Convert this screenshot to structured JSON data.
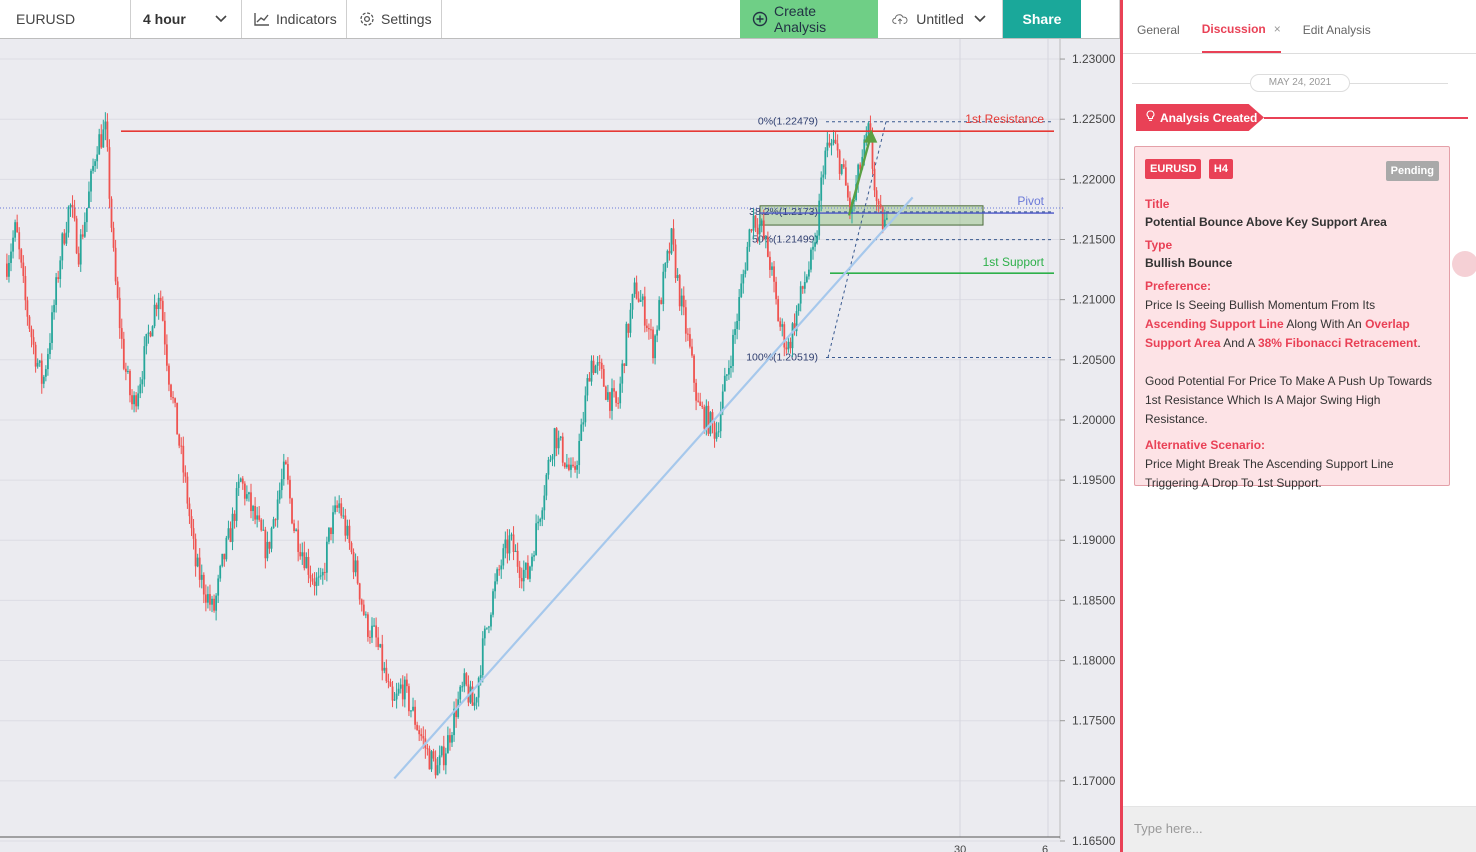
{
  "toolbar": {
    "symbol": "EURUSD",
    "interval": "4 hour",
    "indicators_label": "Indicators",
    "settings_label": "Settings",
    "create_label": "Create Analysis",
    "untitled_label": "Untitled",
    "share_label": "Share",
    "accent_green": "#6fcf86",
    "accent_teal": "#1aa89a"
  },
  "chart": {
    "price_axis": [
      "1.23000",
      "1.22500",
      "1.22000",
      "1.21500",
      "1.21000",
      "1.20500",
      "1.20000",
      "1.19500",
      "1.19000",
      "1.18500",
      "1.18000",
      "1.17500",
      "1.17000",
      "1.16500"
    ],
    "time_axis": [
      "30",
      "6"
    ],
    "annotations": {
      "resistance": "1st Resistance",
      "support": "1st Support",
      "pivot": "Pivot",
      "fib_0": "0%(1.22479)",
      "fib_382": "38.2%(1.2173)",
      "fib_50": "50%(1.21499)",
      "fib_100": "100%(1.20519)"
    },
    "colors": {
      "up": "#26a69a",
      "down": "#ef5350",
      "resistance": "#e53935",
      "support": "#2db04a",
      "trend": "#a6c8ec",
      "pivot": "#4a55c8"
    }
  },
  "chart_data": {
    "type": "candlestick",
    "price_range": [
      1.165,
      1.2315
    ],
    "path_close": [
      1.213,
      1.216,
      1.21,
      1.206,
      1.203,
      1.208,
      1.214,
      1.218,
      1.214,
      1.218,
      1.223,
      1.224,
      1.212,
      1.205,
      1.201,
      1.204,
      1.208,
      1.211,
      1.204,
      1.199,
      1.194,
      1.188,
      1.186,
      1.184,
      1.188,
      1.191,
      1.195,
      1.193,
      1.191,
      1.189,
      1.193,
      1.196,
      1.191,
      1.189,
      1.187,
      1.186,
      1.191,
      1.193,
      1.19,
      1.187,
      1.183,
      1.182,
      1.179,
      1.176,
      1.178,
      1.176,
      1.174,
      1.172,
      1.171,
      1.173,
      1.176,
      1.178,
      1.176,
      1.181,
      1.185,
      1.188,
      1.19,
      1.188,
      1.187,
      1.191,
      1.195,
      1.199,
      1.197,
      1.195,
      1.199,
      1.205,
      1.204,
      1.202,
      1.201,
      1.207,
      1.211,
      1.209,
      1.206,
      1.211,
      1.215,
      1.21,
      1.206,
      1.201,
      1.2,
      1.199,
      1.203,
      1.207,
      1.212,
      1.217,
      1.216,
      1.213,
      1.208,
      1.206,
      1.209,
      1.212,
      1.214,
      1.222,
      1.223,
      1.221,
      1.217,
      1.221,
      1.224,
      1.217,
      1.216
    ],
    "resistance": 1.224,
    "support": 1.2122,
    "pivot": 1.2172,
    "fibonacci": {
      "0": 1.22479,
      "38.2": 1.2173,
      "50": 1.21499,
      "100": 1.20519
    },
    "support_zone": [
      1.2162,
      1.2178
    ],
    "trendline": [
      [
        0.372,
        1.1702
      ],
      [
        0.861,
        1.2185
      ]
    ],
    "projection_arrow": [
      [
        0.801,
        1.217
      ],
      [
        0.822,
        1.2238
      ]
    ]
  },
  "panel": {
    "tabs": [
      "General",
      "Discussion",
      "Edit Analysis"
    ],
    "active_tab_close": "×",
    "date": "MAY 24, 2021",
    "created_label": "Analysis Created",
    "card": {
      "symbol": "EURUSD",
      "timeframe": "H4",
      "status": "Pending",
      "title_label": "Title",
      "title_value": "Potential Bounce Above Key Support Area",
      "type_label": "Type",
      "type_value": "Bullish Bounce",
      "preference_label": "Preference:",
      "pref_t1": "Price Is Seeing Bullish Momentum From Its ",
      "pref_h1": "Ascending Support Line",
      "pref_t2": " Along With An ",
      "pref_h2": "Overlap Support Area",
      "pref_t3": " And A ",
      "pref_h3": "38% Fibonacci Retracement",
      "pref_t4": ".",
      "pref_p2": "Good Potential For Price To Make A Push Up Towards 1st Resistance Which Is A Major Swing High Resistance.",
      "alt_label": "Alternative Scenario:",
      "alt_text": "Price Might Break The Ascending Support Line Triggering A Drop To 1st Support."
    },
    "composer_placeholder": "Type here...",
    "accent": "#e94156"
  }
}
